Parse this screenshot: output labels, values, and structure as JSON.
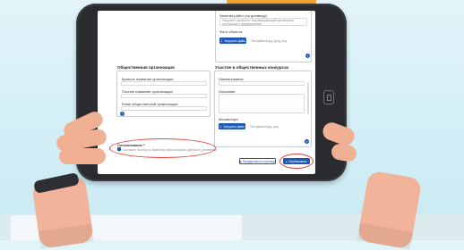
{
  "form": {
    "top_right": {
      "heading": "Занятия работ (по договору)",
      "hint": "Загрузите документ, подтверждающий договорные отношения с предприятием",
      "photo_label": "Фото объекта",
      "upload_label": "Загрузить файл",
      "upload_hint": "Тип файлов jpg, jpeg, png"
    },
    "orgs": {
      "title": "Общественная организация",
      "fields": [
        "Краткое название организации",
        "Полное название организации",
        "Email общественной организации"
      ]
    },
    "contests": {
      "title": "Участие в общественных конкурсах",
      "name_label": "Наименование",
      "desc_label": "Описание",
      "thumb_label": "Миниатюра",
      "upload_label": "Загрузить файл",
      "upload_hint": "Тип файлов jpg, png"
    },
    "consent": {
      "title": "Согласование *",
      "text": "Согласие на сбор и обработку персональных данных и условиями"
    },
    "actions": {
      "preview_label": "Предпросмотр страницы",
      "publish_label": "Опубликовать"
    },
    "plus_symbol": "+"
  },
  "colors": {
    "accent": "#1f59b5",
    "highlight": "#e2453a",
    "background": "#d2eef6",
    "tablet": "#2a2b2f"
  },
  "icons": [
    "upload-icon",
    "eye-icon",
    "checkbox-icon",
    "plus-icon"
  ]
}
